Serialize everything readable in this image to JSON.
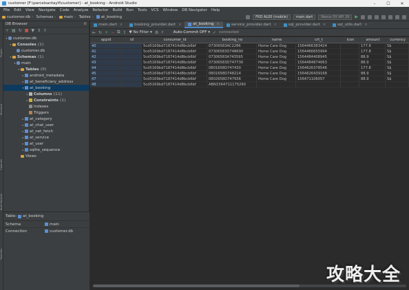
{
  "window": {
    "title": "customer [F:\\parcelsantaylf\\customer] - at_booking - Android Studio",
    "controls": [
      "–",
      "☐",
      "✕"
    ]
  },
  "menu": [
    "File",
    "Edit",
    "View",
    "Navigate",
    "Code",
    "Analyze",
    "Refactor",
    "Build",
    "Run",
    "Tools",
    "VCS",
    "Window",
    "DB Navigator",
    "Help"
  ],
  "nav": {
    "crumbs": [
      "customer.db",
      "Schemas",
      "main",
      "Tables",
      "at_booking"
    ],
    "device_combo": "FRD AL00 (mobile)",
    "file_combo": "main.dart",
    "emulator_combo": "Nexus 5X API 26"
  },
  "db_browser": {
    "title": "DB Browser",
    "tree": [
      {
        "label": "customer.db",
        "count": "",
        "level": 0,
        "icon": "db",
        "arrow": "▾",
        "bold": false,
        "sel": false
      },
      {
        "label": "Consoles",
        "count": "(1)",
        "level": 1,
        "icon": "fold",
        "arrow": "▾",
        "bold": true,
        "sel": false
      },
      {
        "label": "customer.db",
        "count": "",
        "level": 2,
        "icon": "db",
        "arrow": "",
        "bold": false,
        "sel": false
      },
      {
        "label": "Schemas",
        "count": "(1)",
        "level": 1,
        "icon": "fold",
        "arrow": "▾",
        "bold": true,
        "sel": false
      },
      {
        "label": "main",
        "count": "",
        "level": 2,
        "icon": "db",
        "arrow": "▾",
        "bold": false,
        "sel": false
      },
      {
        "label": "Tables",
        "count": "(9)",
        "level": 3,
        "icon": "fold",
        "arrow": "▾",
        "bold": true,
        "sel": false
      },
      {
        "label": "android_metadata",
        "count": "",
        "level": 4,
        "icon": "tbl",
        "arrow": "▸",
        "bold": false,
        "sel": false
      },
      {
        "label": "at_beneficiary_address",
        "count": "",
        "level": 4,
        "icon": "tbl",
        "arrow": "▸",
        "bold": false,
        "sel": false
      },
      {
        "label": "at_booking",
        "count": "",
        "level": 4,
        "icon": "tbl",
        "arrow": "▾",
        "bold": false,
        "sel": true
      },
      {
        "label": "Columns",
        "count": "(11)",
        "level": 5,
        "icon": "col",
        "arrow": "▸",
        "bold": true,
        "sel": false
      },
      {
        "label": "Constraints",
        "count": "(1)",
        "level": 5,
        "icon": "key",
        "arrow": "▸",
        "bold": true,
        "sel": false
      },
      {
        "label": "Indexes",
        "count": "",
        "level": 5,
        "icon": "idx",
        "arrow": "",
        "bold": false,
        "sel": false
      },
      {
        "label": "Triggers",
        "count": "",
        "level": 5,
        "icon": "trg",
        "arrow": "",
        "bold": false,
        "sel": false
      },
      {
        "label": "at_category",
        "count": "",
        "level": 4,
        "icon": "tbl",
        "arrow": "▸",
        "bold": false,
        "sel": false
      },
      {
        "label": "at_chat_user",
        "count": "",
        "level": 4,
        "icon": "tbl",
        "arrow": "▸",
        "bold": false,
        "sel": false
      },
      {
        "label": "at_net_fetch",
        "count": "",
        "level": 4,
        "icon": "tbl",
        "arrow": "▸",
        "bold": false,
        "sel": false
      },
      {
        "label": "at_service",
        "count": "",
        "level": 4,
        "icon": "tbl",
        "arrow": "▸",
        "bold": false,
        "sel": false
      },
      {
        "label": "at_user",
        "count": "",
        "level": 4,
        "icon": "tbl",
        "arrow": "▸",
        "bold": false,
        "sel": false
      },
      {
        "label": "sqlite_sequence",
        "count": "",
        "level": 4,
        "icon": "tbl",
        "arrow": "▸",
        "bold": false,
        "sel": false
      },
      {
        "label": "Views",
        "count": "",
        "level": 3,
        "icon": "fold",
        "arrow": "",
        "bold": false,
        "sel": false
      }
    ]
  },
  "properties": {
    "table_label": "Table:",
    "table_name": "at_booking",
    "rows": [
      {
        "key": "Schema",
        "value": "main"
      },
      {
        "key": "Connection",
        "value": "customer.db"
      }
    ]
  },
  "tabs": [
    {
      "label": "main.dart",
      "active": false
    },
    {
      "label": "booking_provider.dart",
      "active": false
    },
    {
      "label": "at_booking",
      "active": true
    },
    {
      "label": "service_provider.dart",
      "active": false
    },
    {
      "label": "sql_provider.dart",
      "active": false
    },
    {
      "label": "sql_utils.dart",
      "active": false
    }
  ],
  "grid_toolbar": {
    "filter": "No Filter",
    "commit_label": "Auto-Commit OFF",
    "connection": "connected"
  },
  "table": {
    "columns": [
      "appid",
      "id",
      "consumer_id",
      "booking_no",
      "name",
      "crt_t",
      "icon",
      "amount",
      "currency"
    ],
    "rows": [
      [
        "40",
        "",
        "5cd5169bd7187414d8bcb6bf",
        "07306583AC2286",
        "Home Care Dog",
        "1564466383424",
        "",
        "177.8",
        "S$"
      ],
      [
        "41",
        "",
        "5cd5169bd7187414d8bcb6bf",
        "07306583D748690",
        "Home Care Dog",
        "1564466655994",
        "",
        "177.8",
        "S$"
      ],
      [
        "42",
        "",
        "5cd5169bd7187414d8bcb6bf",
        "07306583A743595",
        "Home Care Dog",
        "1564484408945",
        "",
        "88.9",
        "S$"
      ],
      [
        "43",
        "",
        "5cd5169bd7187414d8bcb6bf",
        "07306583D747730",
        "Home Care Dog",
        "1564484874063",
        "",
        "88.9",
        "S$"
      ],
      [
        "44",
        "",
        "5cd5169bd7187414d8bcb6bf",
        "0801658D747430",
        "Home Care Dog",
        "1564626378546",
        "",
        "177.8",
        "S$"
      ],
      [
        "45",
        "",
        "5cd5169bd7187414d8bcb6bf",
        "0801658D748214",
        "Home Care Dog",
        "1564626439168",
        "",
        "88.9",
        "S$"
      ],
      [
        "47",
        "",
        "5cd5169bd7187414d8bcb6bf",
        "0802658D747936",
        "Home Care Dog",
        "156471106057",
        "",
        "88.9",
        "S$"
      ],
      [
        "48",
        "",
        "5cd5169bd7187414d8bcb6bf",
        "ABN1564711175290",
        "",
        "",
        "",
        "",
        ""
      ]
    ]
  },
  "left_strip_labels": [
    "Project",
    "Structure",
    "Captures",
    "Build Variants",
    "Favorites"
  ],
  "watermark": "攻略大全"
}
